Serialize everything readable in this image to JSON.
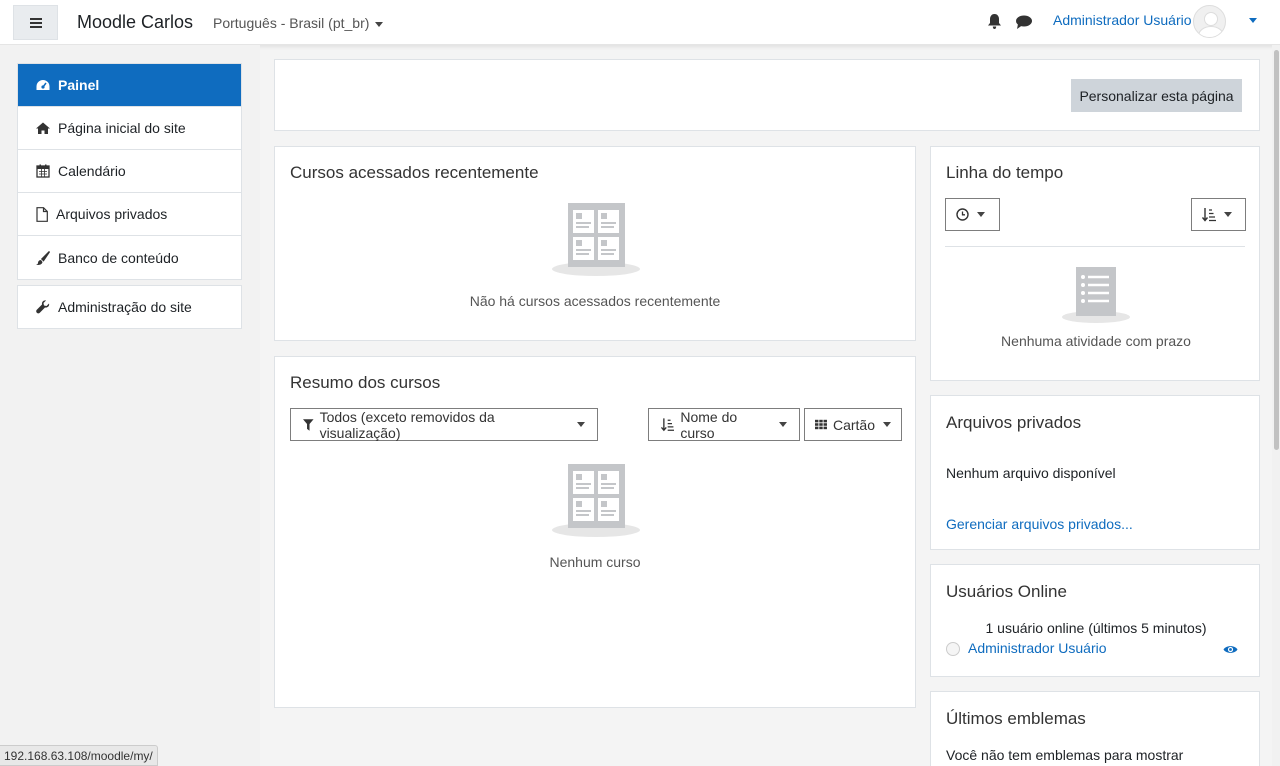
{
  "header": {
    "brand": "Moodle Carlos",
    "language": "Português - Brasil (pt_br)",
    "user_name": "Administrador Usuário"
  },
  "sidebar": {
    "items": [
      {
        "label": "Painel",
        "icon": "tachometer-icon",
        "active": true
      },
      {
        "label": "Página inicial do site",
        "icon": "home-icon"
      },
      {
        "label": "Calendário",
        "icon": "calendar-icon"
      },
      {
        "label": "Arquivos privados",
        "icon": "file-icon"
      },
      {
        "label": "Banco de conteúdo",
        "icon": "paintbrush-icon"
      }
    ],
    "admin": {
      "label": "Administração do site",
      "icon": "wrench-icon"
    }
  },
  "main": {
    "customize_button": "Personalizar esta página",
    "recent_courses": {
      "title": "Cursos acessados recentemente",
      "empty": "Não há cursos acessados recentemente"
    },
    "course_overview": {
      "title": "Resumo dos cursos",
      "filter": "Todos (exceto removidos da visualização)",
      "sort": "Nome do curso",
      "view": "Cartão",
      "empty": "Nenhum curso"
    }
  },
  "blocks": {
    "timeline": {
      "title": "Linha do tempo",
      "empty": "Nenhuma atividade com prazo"
    },
    "private_files": {
      "title": "Arquivos privados",
      "empty": "Nenhum arquivo disponível",
      "manage_link": "Gerenciar arquivos privados..."
    },
    "online_users": {
      "title": "Usuários Online",
      "summary": "1 usuário online (últimos 5 minutos)",
      "user": "Administrador Usuário"
    },
    "badges": {
      "title": "Últimos emblemas",
      "empty": "Você não tem emblemas para mostrar"
    }
  },
  "status_bar": {
    "url": "192.168.63.108/moodle/my/"
  },
  "colors": {
    "primary": "#0f6cbf",
    "background": "#f4f4f4",
    "button_gray": "#ced4da"
  }
}
